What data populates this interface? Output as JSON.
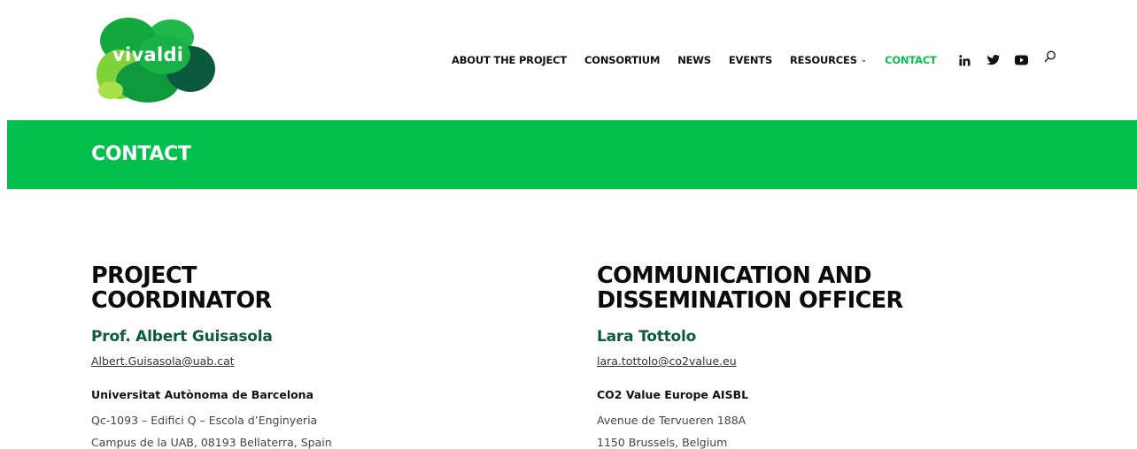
{
  "logo": {
    "text": "vivaldi"
  },
  "nav": {
    "items": [
      {
        "label": "ABOUT THE PROJECT"
      },
      {
        "label": "CONSORTIUM"
      },
      {
        "label": "NEWS"
      },
      {
        "label": "EVENTS"
      },
      {
        "label": "RESOURCES"
      }
    ],
    "contact_label": "CONTACT",
    "resources_chevron": "⌄",
    "social": [
      "linkedin-icon",
      "twitter-icon",
      "youtube-icon",
      "search-icon"
    ]
  },
  "colors": {
    "brand_green": "#03bf4d",
    "name_green": "#0e5a3a"
  },
  "banner": {
    "title": "CONTACT"
  },
  "left": {
    "heading_line1": "PROJECT",
    "heading_line2": "COORDINATOR",
    "name": "Prof. Albert Guisasola",
    "email": "Albert.Guisasola@uab.cat",
    "org": "Universitat Autònoma de Barcelona",
    "addr_line1": "Qc-1093 – Edifici Q – Escola d’Enginyeria",
    "addr_line2": "Campus de la UAB, 08193 Bellaterra, Spain"
  },
  "right": {
    "heading_line1": "COMMUNICATION AND",
    "heading_line2": "DISSEMINATION OFFICER",
    "name": "Lara Tottolo",
    "email": "lara.tottolo@co2value.eu",
    "org": "CO2 Value Europe AISBL",
    "addr_line1": "Avenue de Tervueren 188A",
    "addr_line2": "1150 Brussels, Belgium"
  }
}
